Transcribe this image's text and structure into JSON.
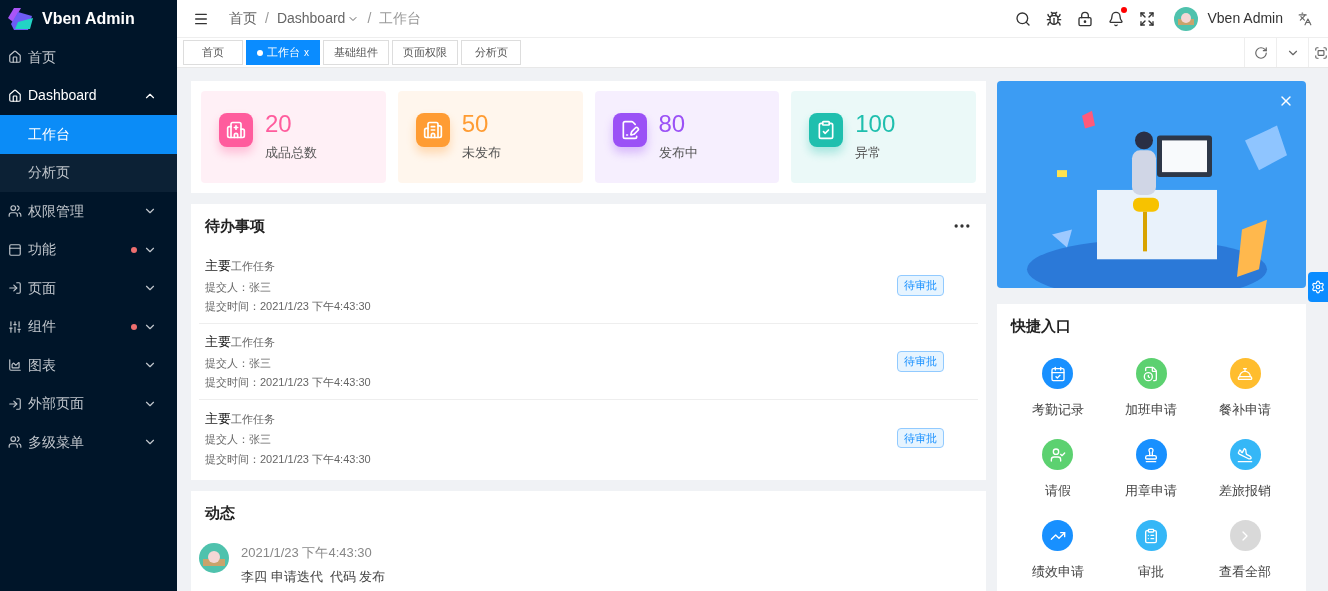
{
  "sidebar": {
    "logo": "Vben Admin",
    "items": [
      {
        "label": "首页",
        "kind": "link",
        "dot": false
      },
      {
        "label": "Dashboard",
        "kind": "submenu",
        "expanded": true,
        "dot": false,
        "children": [
          {
            "label": "工作台",
            "selected": true
          },
          {
            "label": "分析页",
            "selected": false
          }
        ]
      },
      {
        "label": "权限管理",
        "kind": "submenu",
        "expanded": false,
        "dot": false
      },
      {
        "label": "功能",
        "kind": "submenu",
        "expanded": false,
        "dot": true
      },
      {
        "label": "页面",
        "kind": "submenu",
        "expanded": false,
        "dot": false
      },
      {
        "label": "组件",
        "kind": "submenu",
        "expanded": false,
        "dot": true
      },
      {
        "label": "图表",
        "kind": "submenu",
        "expanded": false,
        "dot": false
      },
      {
        "label": "外部页面",
        "kind": "submenu",
        "expanded": false,
        "dot": false
      },
      {
        "label": "多级菜单",
        "kind": "submenu",
        "expanded": false,
        "dot": false
      }
    ]
  },
  "header": {
    "breadcrumb": [
      {
        "label": "首页",
        "dropdown": false
      },
      {
        "label": "Dashboard",
        "dropdown": true
      },
      {
        "label": "工作台",
        "dropdown": false
      }
    ],
    "separator": "/",
    "notification_dot": true,
    "user": "Vben Admin"
  },
  "tabs": [
    {
      "label": "首页",
      "selected": false
    },
    {
      "label": "工作台",
      "selected": true,
      "close": "x"
    },
    {
      "label": "基础组件",
      "selected": false
    },
    {
      "label": "页面权限",
      "selected": false
    },
    {
      "label": "分析页",
      "selected": false
    }
  ],
  "stats": [
    {
      "value": "20",
      "label": "成品总数",
      "color": "#ff5c9d"
    },
    {
      "value": "50",
      "label": "未发布",
      "color": "#ff9c33"
    },
    {
      "value": "80",
      "label": "发布中",
      "color": "#9b51f6"
    },
    {
      "value": "100",
      "label": "异常",
      "color": "#1fbfae"
    }
  ],
  "todo": {
    "title": "待办事项",
    "items": [
      {
        "title": "主要",
        "subtitle": "工作任务",
        "submitter": "提交人：张三",
        "time": "提交时间：2021/1/23 下午4:43:30",
        "status": "待审批"
      },
      {
        "title": "主要",
        "subtitle": "工作任务",
        "submitter": "提交人：张三",
        "time": "提交时间：2021/1/23 下午4:43:30",
        "status": "待审批"
      },
      {
        "title": "主要",
        "subtitle": "工作任务",
        "submitter": "提交人：张三",
        "time": "提交时间：2021/1/23 下午4:43:30",
        "status": "待审批"
      }
    ]
  },
  "activity": {
    "title": "动态",
    "items": [
      {
        "time": "2021/1/23 下午4:43:30",
        "text": "李四 申请迭代  代码 发布"
      }
    ]
  },
  "quick_entry": {
    "title": "快捷入口",
    "items": [
      {
        "label": "考勤记录",
        "color": "#1890ff"
      },
      {
        "label": "加班申请",
        "color": "#5cd170"
      },
      {
        "label": "餐补申请",
        "color": "#ffbd2e"
      },
      {
        "label": "请假",
        "color": "#5cd170"
      },
      {
        "label": "用章申请",
        "color": "#1890ff"
      },
      {
        "label": "差旅报销",
        "color": "#35b7f7"
      },
      {
        "label": "绩效申请",
        "color": "#1890ff"
      },
      {
        "label": "审批",
        "color": "#35b7f7"
      },
      {
        "label": "查看全部",
        "color": "#d9d9d9"
      }
    ]
  }
}
